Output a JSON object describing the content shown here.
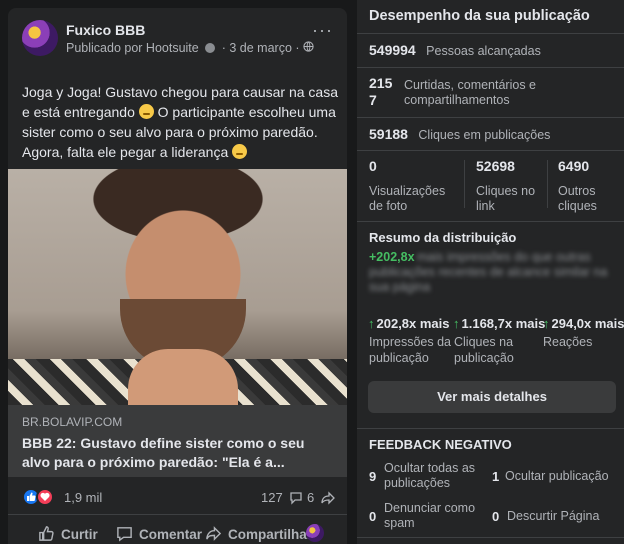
{
  "post": {
    "page_name": "Fuxico BBB",
    "meta_text": "Publicado por Hootsuite",
    "date": "3 de março",
    "separator": "·",
    "more": "···",
    "text_1": "Joga y Joga! Gustavo chegou para causar na casa e está entregando",
    "text_2": " O participante escolheu uma sister como o seu alvo para o próximo paredão. Agora, falta ele pegar a liderança",
    "link_domain": "BR.BOLAVIP.COM",
    "link_title": "BBB 22: Gustavo define sister como o seu alvo para o próximo paredão: \"Ela é a...",
    "reaction_count": "1,9 mil",
    "comment_count": "127",
    "share_count": "6",
    "actions": {
      "like": "Curtir",
      "comment": "Comentar",
      "share": "Compartilhar"
    }
  },
  "insights": {
    "title": "Desempenho da sua publicação",
    "reach_value": "549994",
    "reach_label": "Pessoas alcançadas",
    "engagement_value_1": "215",
    "engagement_value_2": "7",
    "engagement_label": "Curtidas, comentários e compartilhamentos",
    "clicks_value": "59188",
    "clicks_label": "Cliques em publicações",
    "breakdown": [
      {
        "value": "0",
        "label": "Visualizações de foto"
      },
      {
        "value": "52698",
        "label": "Cliques no link"
      },
      {
        "value": "6490",
        "label": "Outros cliques"
      }
    ],
    "distribution_title": "Resumo da distribuição",
    "distribution_highlight": "+202,8x",
    "distribution_blurred": "mais impressões do que outras publicações recentes de alcance similar na sua página",
    "ratios": [
      {
        "value": "202,8x mais",
        "label": "Impressões da publicação"
      },
      {
        "value": "1.168,7x mais",
        "label": "Cliques na publicação"
      },
      {
        "value": "294,0x mais",
        "label": "Reações"
      }
    ],
    "details_button": "Ver mais detalhes",
    "negative_title": "FEEDBACK NEGATIVO",
    "negative": [
      {
        "value": "9",
        "label": "Ocultar todas as publicações"
      },
      {
        "value": "1",
        "label": "Ocultar publicação"
      },
      {
        "value": "0",
        "label": "Denunciar como spam"
      },
      {
        "value": "0",
        "label": "Descurtir Página"
      }
    ]
  },
  "colors": {
    "background": "#18191a",
    "card": "#242526",
    "accent_green": "#45bd62",
    "like_blue": "#1877f2",
    "love_red": "#f33e58"
  }
}
